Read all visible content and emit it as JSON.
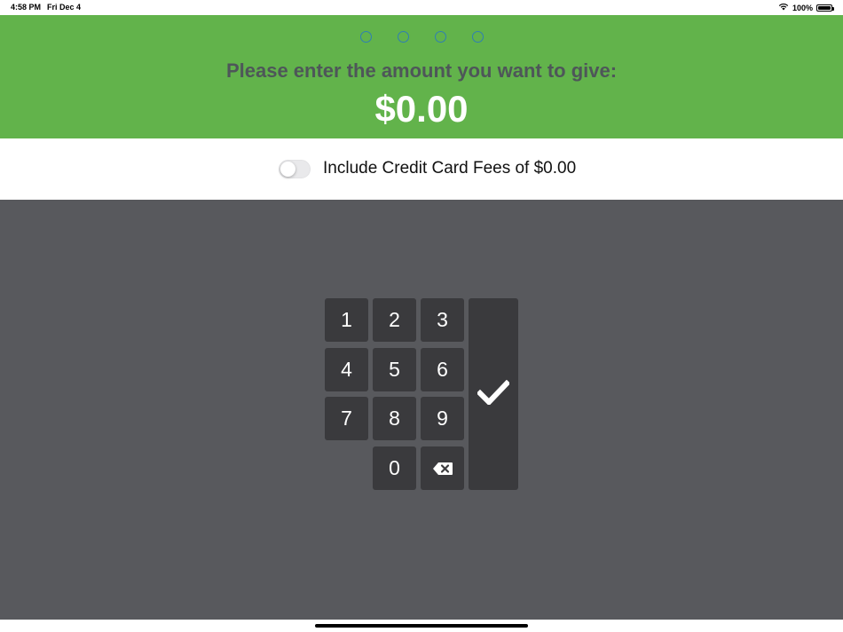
{
  "status_bar": {
    "time": "4:58 PM",
    "date": "Fri Dec 4",
    "battery_percent": "100%",
    "icons": [
      "wifi-icon",
      "battery-icon"
    ]
  },
  "header": {
    "steps_total": 4,
    "prompt": "Please enter the amount you want to give:",
    "amount": "$0.00",
    "background_color": "#62b34b"
  },
  "fees": {
    "toggle_on": false,
    "label": "Include Credit Card Fees of $0.00"
  },
  "keypad": {
    "keys": [
      "1",
      "2",
      "3",
      "4",
      "5",
      "6",
      "7",
      "8",
      "9",
      "0"
    ],
    "backspace_icon": "backspace-icon",
    "submit_icon": "checkmark-icon",
    "background_color": "#58595d",
    "key_color": "#3a3a3d"
  }
}
